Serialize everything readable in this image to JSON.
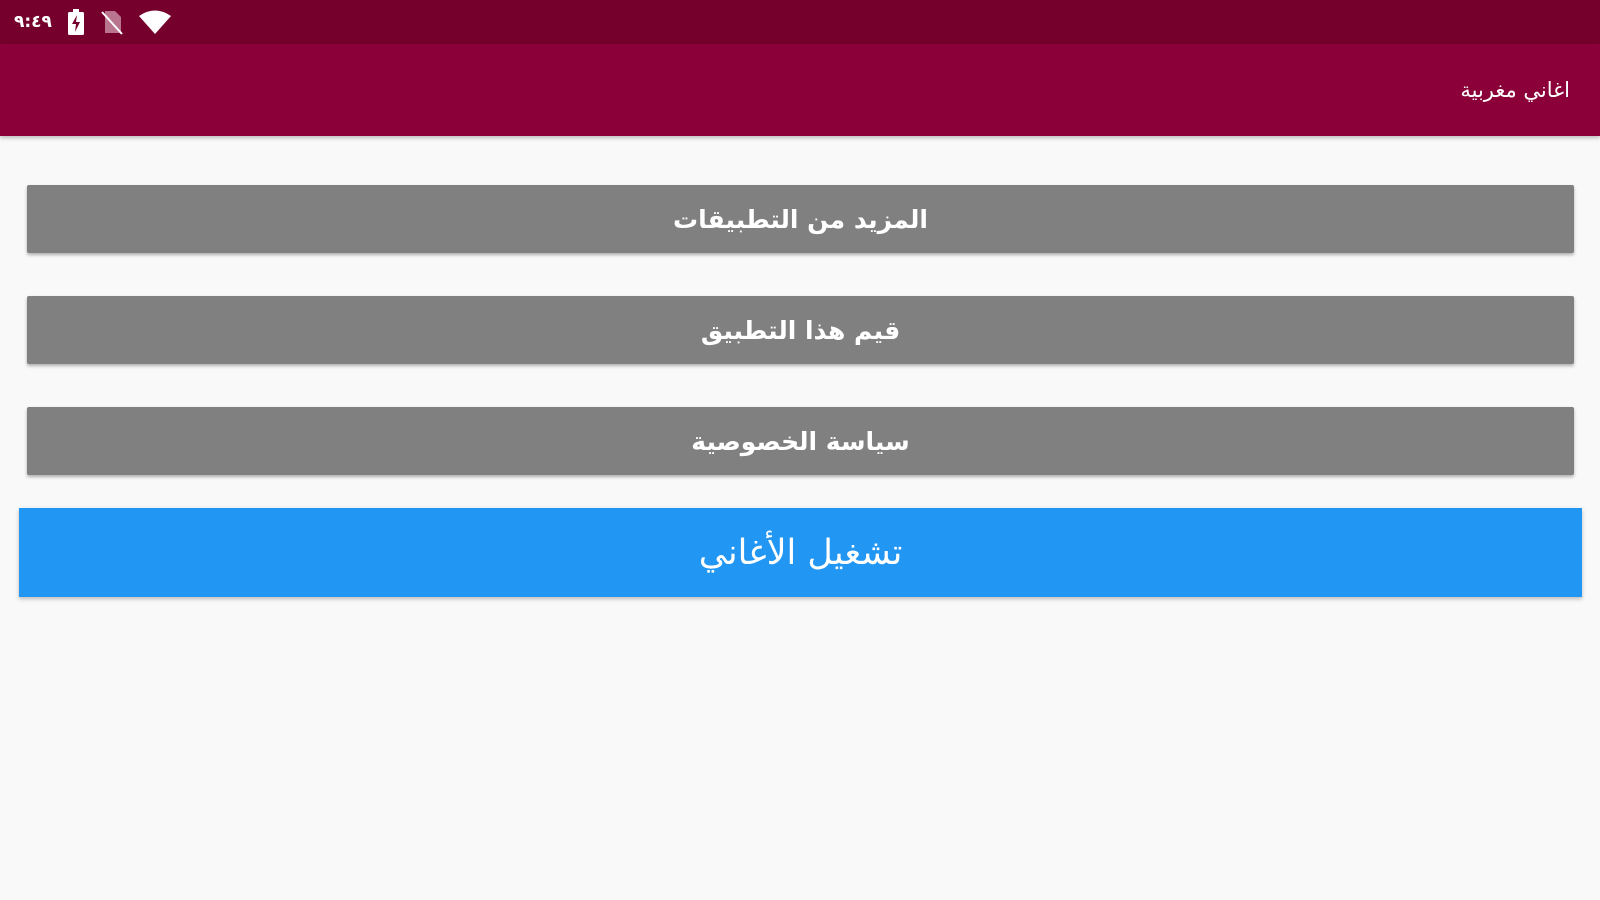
{
  "status_bar": {
    "time": "٩:٤٩",
    "icons": [
      "battery-charging-icon",
      "no-sim-icon",
      "wifi-icon"
    ]
  },
  "app_bar": {
    "title": "اغاني مغربية"
  },
  "menu": {
    "more_apps": "المزيد من التطبيقات",
    "rate_app": "قيم هذا التطبيق",
    "privacy_policy": "سياسة الخصوصية"
  },
  "play_button": {
    "label": "تشغيل الأغاني"
  },
  "colors": {
    "status_bar": "#75002b",
    "app_bar": "#8b0038",
    "menu_button": "#808080",
    "play_button": "#2196f3",
    "background": "#f9f9f9"
  }
}
